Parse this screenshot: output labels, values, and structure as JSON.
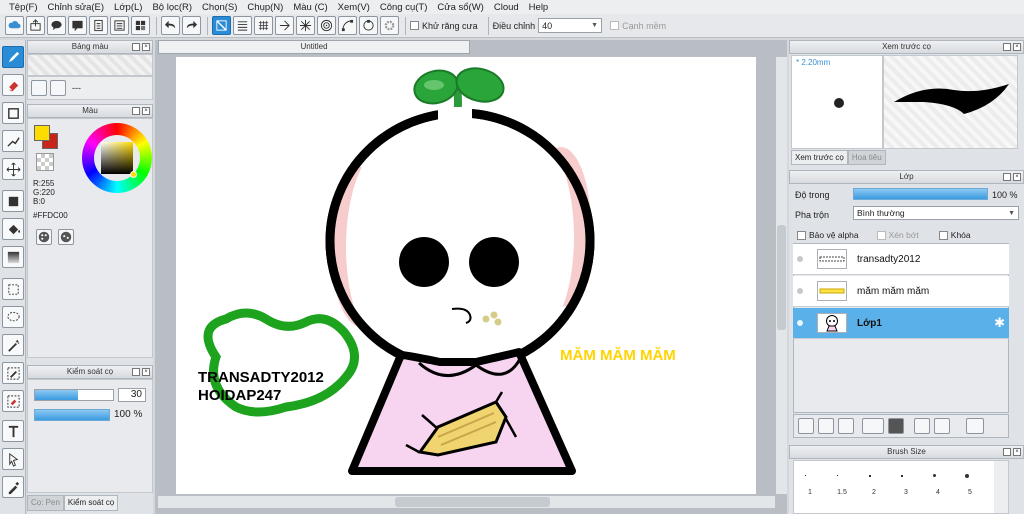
{
  "menu": [
    "Tệp(F)",
    "Chỉnh sửa(E)",
    "Lớp(L)",
    "Bộ lọc(R)",
    "Chọn(S)",
    "Chụp(N)",
    "Màu (C)",
    "Xem(V)",
    "Công cụ(T)",
    "Cửa sổ(W)",
    "Cloud",
    "Help"
  ],
  "toolbar": {
    "antialias_label": "Khử răng cưa",
    "adjust_label": "Điều chỉnh",
    "adjust_value": "40",
    "edge_label": "Cạnh mềm"
  },
  "left_panel": {
    "palette_title": "Bảng màu",
    "palette_text": "---",
    "color_title": "Màu",
    "rgb_r": "R:255",
    "rgb_g": "G:220",
    "rgb_b": "B:0",
    "hex": "#FFDC00",
    "control_title": "Kiểm soát cọ",
    "size_value": "30",
    "opacity_value": "100 %",
    "tab_pen": "Cọ: Pen",
    "tab_control": "Kiểm soát cọ",
    "colors": {
      "fg": "#FFDC00",
      "bg": "#C8241A"
    }
  },
  "document": {
    "tab_title": "Untitled",
    "text_left_1": "TRANSADTY2012",
    "text_left_2": "HOIDAP247",
    "text_right": "MĂM MĂM MĂM"
  },
  "preview": {
    "title": "Xem trước cọ",
    "size": "* 2.20mm",
    "tab_preview": "Xem trước cọ",
    "tab_pattern": "Hoa tiêu"
  },
  "layers": {
    "title": "Lớp",
    "opacity_label": "Độ trong",
    "opacity_value": "100 %",
    "blend_label": "Pha trộn",
    "blend_value": "Bình thường",
    "protect_alpha": "Bảo vệ alpha",
    "clipping": "Xén bớt",
    "lock": "Khóa",
    "items": [
      {
        "name": "transadty2012"
      },
      {
        "name": "măm măm măm"
      },
      {
        "name": "Lớp1"
      }
    ]
  },
  "brush_size": {
    "title": "Brush Size",
    "labels": [
      "1",
      "1.5",
      "2",
      "3",
      "4",
      "5"
    ]
  }
}
